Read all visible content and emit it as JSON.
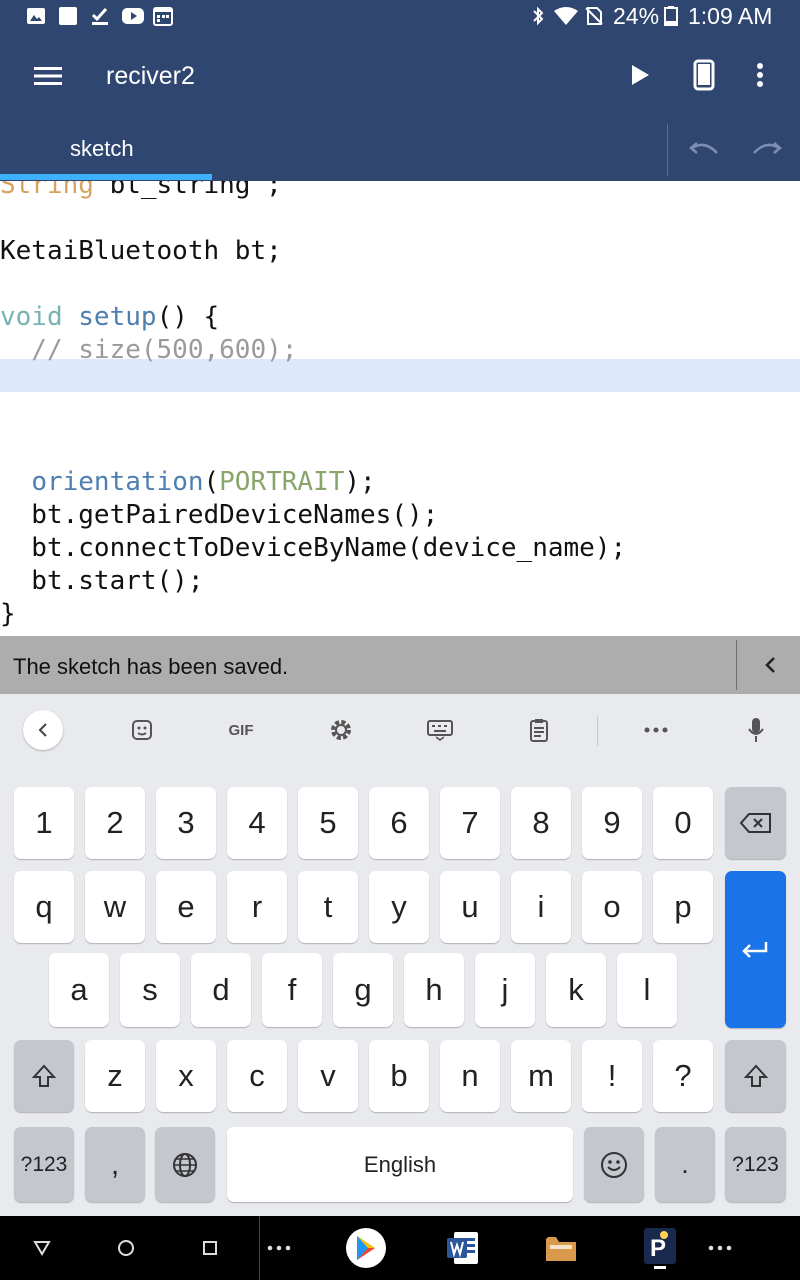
{
  "status_bar": {
    "battery": "24%",
    "time": "1:09 AM",
    "left_icons": [
      "image-icon",
      "square-icon",
      "checkmark-download-icon",
      "youtube-icon",
      "calendar-icon"
    ],
    "right_icons": [
      "bluetooth-icon",
      "wifi-icon",
      "no-sim-icon",
      "battery-icon"
    ]
  },
  "app_bar": {
    "title": "reciver2",
    "tab": "sketch",
    "icons": [
      "menu-icon",
      "play-icon",
      "device-icon",
      "more-vert-icon",
      "undo-icon",
      "redo-icon"
    ],
    "accent": "#3db1ff",
    "background": "#2f4670"
  },
  "editor": {
    "lines": [
      {
        "parts": [
          {
            "text": "String",
            "cls": "ty"
          },
          {
            "text": " bt_string ;",
            "cls": ""
          }
        ]
      },
      {
        "parts": [
          {
            "text": "",
            "cls": ""
          }
        ]
      },
      {
        "parts": [
          {
            "text": "KetaiBluetooth bt;",
            "cls": ""
          }
        ]
      },
      {
        "parts": [
          {
            "text": "",
            "cls": ""
          }
        ]
      },
      {
        "parts": [
          {
            "text": "void",
            "cls": "kw"
          },
          {
            "text": " ",
            "cls": ""
          },
          {
            "text": "setup",
            "cls": "fn"
          },
          {
            "text": "() {",
            "cls": ""
          }
        ]
      },
      {
        "parts": [
          {
            "text": "  // size(500,600);",
            "cls": "cm"
          }
        ]
      },
      {
        "parts": [
          {
            "text": "",
            "cls": ""
          }
        ]
      },
      {
        "parts": [
          {
            "text": "",
            "cls": ""
          }
        ]
      },
      {
        "parts": [
          {
            "text": "",
            "cls": ""
          }
        ]
      },
      {
        "parts": [
          {
            "text": "  ",
            "cls": ""
          },
          {
            "text": "orientation",
            "cls": "fn"
          },
          {
            "text": "(",
            "cls": ""
          },
          {
            "text": "PORTRAIT",
            "cls": "ct"
          },
          {
            "text": ");",
            "cls": ""
          }
        ]
      },
      {
        "parts": [
          {
            "text": "  bt.getPairedDeviceNames();",
            "cls": ""
          }
        ]
      },
      {
        "parts": [
          {
            "text": "  bt.connectToDeviceByName(device_name);",
            "cls": ""
          }
        ]
      },
      {
        "parts": [
          {
            "text": "  bt.start();",
            "cls": ""
          }
        ]
      },
      {
        "parts": [
          {
            "text": "}",
            "cls": ""
          }
        ]
      }
    ]
  },
  "message_bar": {
    "text": "The sketch has been saved.",
    "collapse_icon": "chevron-left-icon"
  },
  "keyboard": {
    "toolbar_icons": [
      "back-chevron-icon",
      "sticker-icon",
      "gif-icon",
      "settings-icon",
      "keyboard-icon",
      "clipboard-icon",
      "more-icon",
      "mic-icon"
    ],
    "gif_label": "GIF",
    "row_numbers": [
      "1",
      "2",
      "3",
      "4",
      "5",
      "6",
      "7",
      "8",
      "9",
      "0"
    ],
    "row_q": [
      "q",
      "w",
      "e",
      "r",
      "t",
      "y",
      "u",
      "i",
      "o",
      "p"
    ],
    "row_a": [
      "a",
      "s",
      "d",
      "f",
      "g",
      "h",
      "j",
      "k",
      "l"
    ],
    "row_z": [
      "z",
      "x",
      "c",
      "v",
      "b",
      "n",
      "m",
      "!",
      "?"
    ],
    "symbols_label": "?123",
    "comma": ",",
    "space_label": "English",
    "period": ".",
    "enter_color": "#1a73e8"
  },
  "nav_bar": {
    "icons": [
      "back-triangle-icon",
      "home-circle-icon",
      "recents-square-icon",
      "dots-icon",
      "play-store-icon",
      "word-icon",
      "files-icon",
      "processing-icon",
      "dots-icon"
    ]
  }
}
